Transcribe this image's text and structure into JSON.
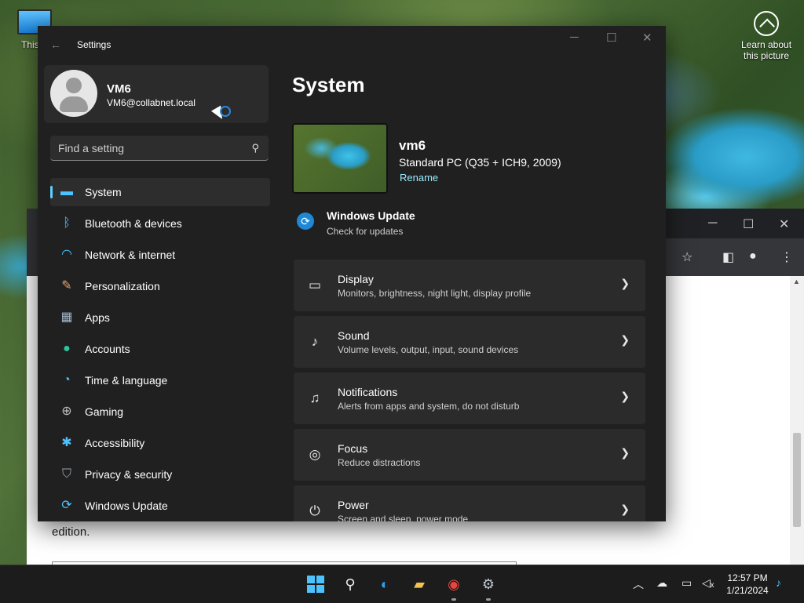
{
  "desktop": {
    "icon_label": "This P",
    "learn_label": "Learn about this picture"
  },
  "browser": {
    "body_text": "edition."
  },
  "settings": {
    "window_title": "Settings",
    "profile": {
      "name": "VM6",
      "email": "VM6@collabnet.local"
    },
    "search_placeholder": "Find a setting",
    "nav": [
      {
        "label": "System",
        "icon": "monitor-icon",
        "active": true
      },
      {
        "label": "Bluetooth & devices",
        "icon": "bluetooth-icon"
      },
      {
        "label": "Network & internet",
        "icon": "wifi-icon"
      },
      {
        "label": "Personalization",
        "icon": "brush-icon"
      },
      {
        "label": "Apps",
        "icon": "apps-icon"
      },
      {
        "label": "Accounts",
        "icon": "person-icon"
      },
      {
        "label": "Time & language",
        "icon": "globe-clock-icon"
      },
      {
        "label": "Gaming",
        "icon": "gamepad-icon"
      },
      {
        "label": "Accessibility",
        "icon": "accessibility-icon"
      },
      {
        "label": "Privacy & security",
        "icon": "shield-icon"
      },
      {
        "label": "Windows Update",
        "icon": "update-icon"
      }
    ],
    "page_title": "System",
    "device": {
      "name": "vm6",
      "model": "Standard PC (Q35 + ICH9, 2009)",
      "rename_label": "Rename"
    },
    "windows_update": {
      "title": "Windows Update",
      "subtitle": "Check for updates"
    },
    "cards": [
      {
        "title": "Display",
        "subtitle": "Monitors, brightness, night light, display profile",
        "icon": "display-icon"
      },
      {
        "title": "Sound",
        "subtitle": "Volume levels, output, input, sound devices",
        "icon": "speaker-icon"
      },
      {
        "title": "Notifications",
        "subtitle": "Alerts from apps and system, do not disturb",
        "icon": "bell-icon"
      },
      {
        "title": "Focus",
        "subtitle": "Reduce distractions",
        "icon": "focus-icon"
      },
      {
        "title": "Power",
        "subtitle": "Screen and sleep, power mode",
        "icon": "power-icon"
      }
    ]
  },
  "taskbar": {
    "apps": [
      "start-icon",
      "search-icon",
      "edge-dev-icon",
      "file-explorer-icon",
      "chrome-icon",
      "settings-icon"
    ],
    "clock": {
      "time": "12:57 PM",
      "date": "1/21/2024"
    },
    "accent": "#4cc2ff"
  }
}
